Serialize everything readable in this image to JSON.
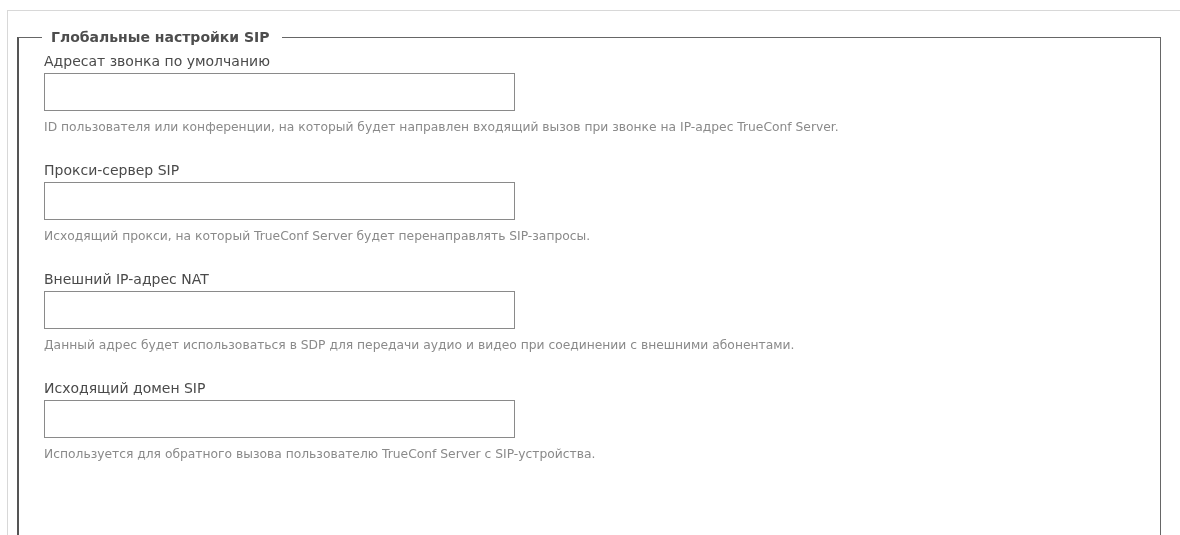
{
  "section": {
    "title": "Глобальные настройки SIP"
  },
  "fields": [
    {
      "label": "Адресат звонка по умолчанию",
      "hint": "ID пользователя или конференции, на который будет направлен входящий вызов при звонке на IP-адрес TrueConf Server."
    },
    {
      "label": "Прокси-сервер SIP",
      "hint": "Исходящий прокси, на который TrueConf Server будет перенаправлять SIP-запросы."
    },
    {
      "label": "Внешний IP-адрес NAT",
      "hint": "Данный адрес будет использоваться в SDP для передачи аудио и видео при соединении с внешними абонентами."
    },
    {
      "label": "Исходящий домен SIP",
      "hint": "Используется для обратного вызова пользователю TrueConf Server с SIP-устройства."
    }
  ]
}
